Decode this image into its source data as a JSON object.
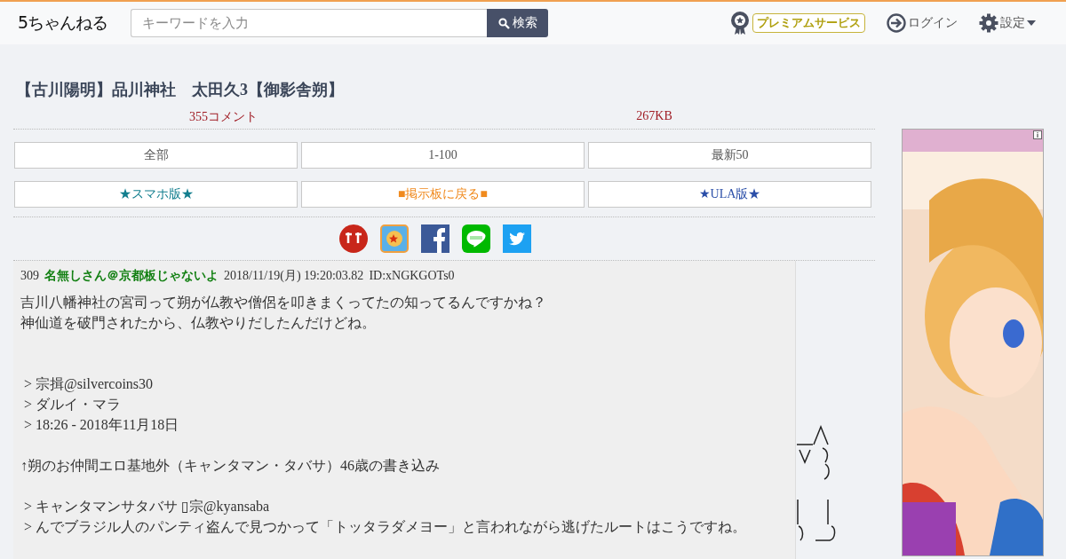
{
  "header": {
    "logo": "5ちゃんねる",
    "search": {
      "placeholder": "キーワードを入力"
    },
    "search_button": "検索",
    "premium": "プレミアムサービス",
    "login": "ログイン",
    "settings": "設定"
  },
  "thread": {
    "title": "【古川陽明】品川神社　太田久3【御影舎朔】",
    "stats": [
      "355コメント",
      "267KB"
    ],
    "nav_rows": [
      [
        {
          "label": "全部",
          "kind": "plain"
        },
        {
          "label": "1-100",
          "kind": "plain"
        },
        {
          "label": "最新50",
          "kind": "plain"
        }
      ],
      [
        {
          "label": "★スマホ版★",
          "kind": "mobile"
        },
        {
          "label": "■掲示板に戻る■",
          "kind": "board"
        },
        {
          "label": "★ULA版★",
          "kind": "ula"
        }
      ]
    ]
  },
  "post": {
    "number": "309",
    "name": "名無しさん＠京都板じゃないよ",
    "date": "2018/11/19(月) 19:20:03.82",
    "id": "ID:xNGKGOTs0",
    "paragraphs": [
      [
        "吉川八幡神社の宮司って朔が仏教や僧侶を叩きまくってたの知ってるんですかね？",
        "神仙道を破門されたから、仏教やりだしたんだけどね。"
      ],
      [
        " > 宗揖@silvercoins30",
        " > ダルイ・マラ",
        " > 18:26 - 2018年11月18日"
      ],
      [
        "↑朔のお仲間エロ基地外（キャンタマン・タバサ）46歳の書き込み"
      ],
      [
        " > キャンタマンサタバサ ▯宗@kyansaba",
        " > んでブラジル人のパンティ盗んで見つかって「トッタラダメヨー」と言われながら逃げたルートはこうですね。"
      ]
    ]
  }
}
